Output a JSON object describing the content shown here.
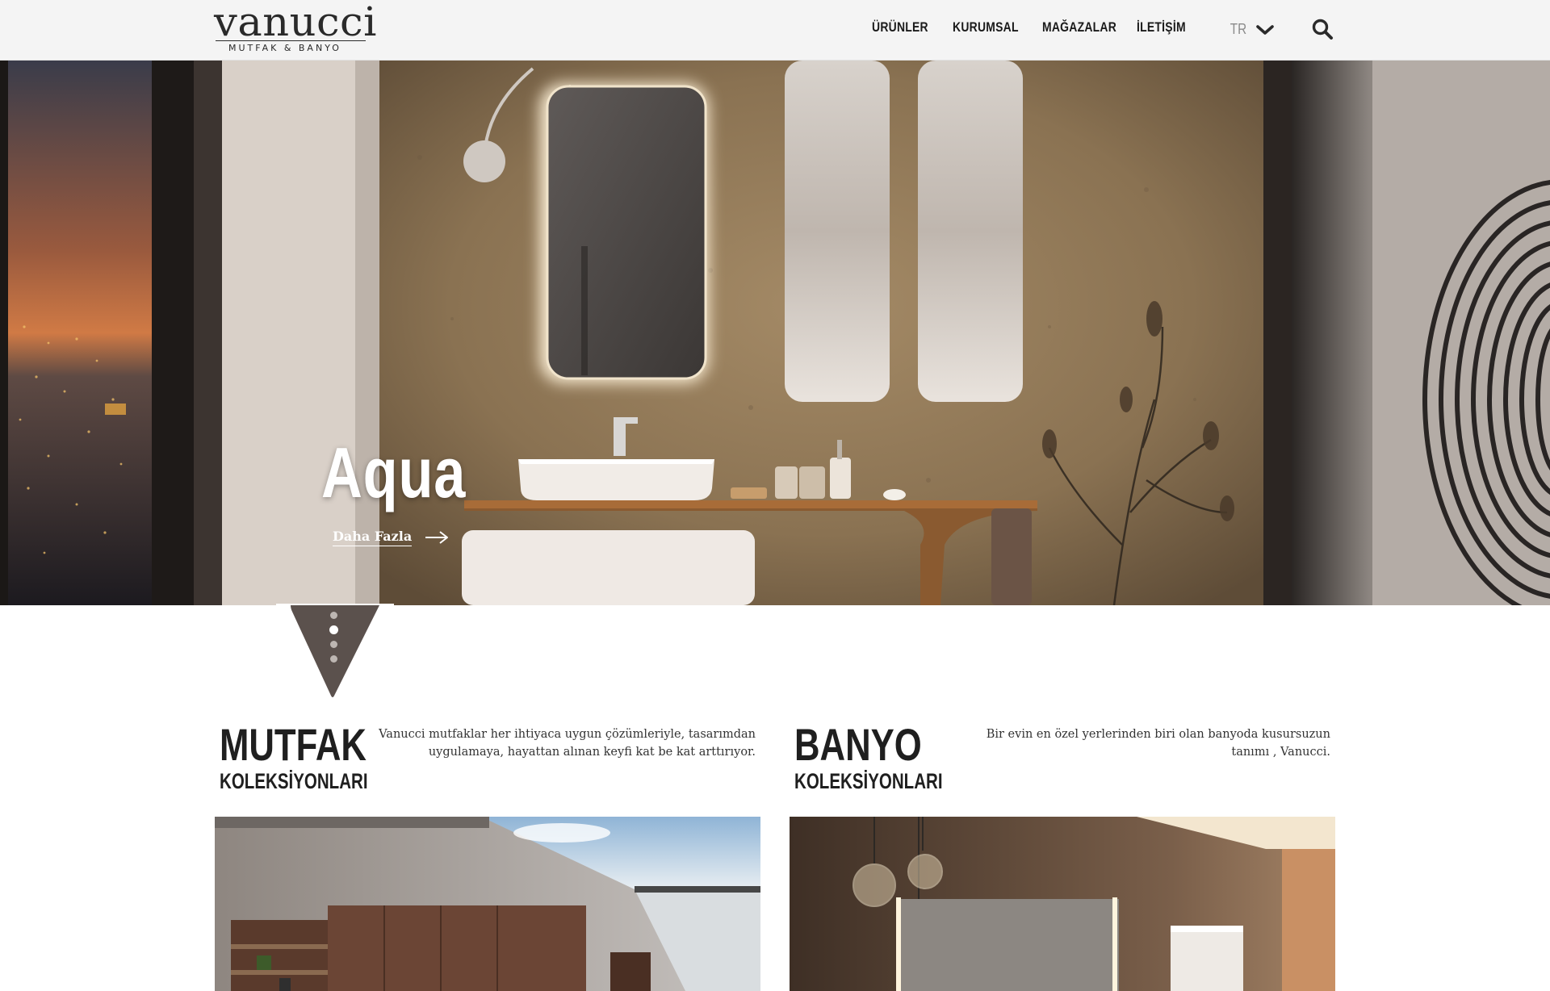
{
  "header": {
    "logo_word": "vanucci",
    "logo_sub": "MUTFAK & BANYO",
    "nav": [
      "ÜRÜNLER",
      "KURUMSAL",
      "MAĞAZALAR",
      "İLETİŞİM"
    ],
    "language": "TR"
  },
  "hero": {
    "title": "Aqua",
    "more_label": "Daha Fazla",
    "slides_count": 4,
    "active_slide": 2
  },
  "sections": {
    "kitchen": {
      "title": "MUTFAK",
      "subtitle": "KOLEKSİYONLARI",
      "description": "Vanucci mutfaklar her ihtiyaca uygun çözümleriyle, tasarımdan uygulamaya, hayattan alınan keyfi kat be kat arttırıyor."
    },
    "bathroom": {
      "title": "BANYO",
      "subtitle": "KOLEKSİYONLARI",
      "description": "Bir evin en özel yerlerinden biri olan banyoda kusursuzun tanımı , Vanucci."
    }
  },
  "colors": {
    "header_bg": "#f4f4f4",
    "text_dark": "#1f1f1f",
    "wall_tan": "#8c7558"
  },
  "icons": [
    "chevron-down-icon",
    "search-icon",
    "arrow-right-icon"
  ]
}
